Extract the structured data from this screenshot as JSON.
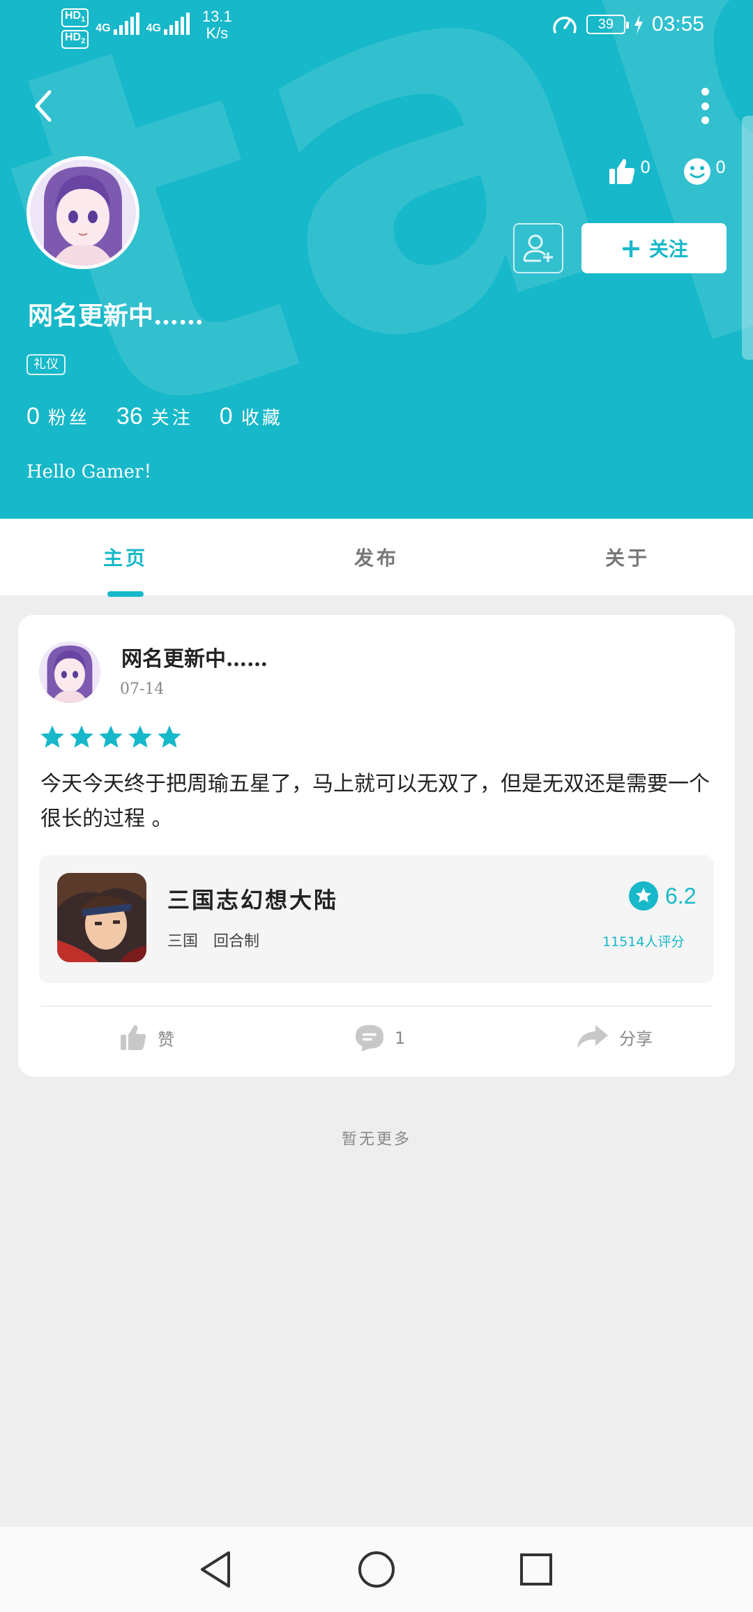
{
  "status_bar": {
    "hd1": "HD",
    "hd1_sub": "1",
    "hd2": "HD",
    "hd2_sub": "2",
    "net1": "4G",
    "net2": "4G",
    "speed_value": "13.1",
    "speed_unit": "K/s",
    "battery": "39",
    "time": "03:55"
  },
  "header": {
    "watermark": "tapTap",
    "like_count": "0",
    "face_count": "0",
    "follow_label": "关注",
    "user_name": "网名更新中……",
    "tag": "礼仪",
    "stats": [
      {
        "num": "0",
        "label": "粉丝"
      },
      {
        "num": "36",
        "label": "关注"
      },
      {
        "num": "0",
        "label": "收藏"
      }
    ],
    "bio": "Hello Gamer！"
  },
  "tabs": [
    {
      "label": "主页",
      "active": true
    },
    {
      "label": "发布",
      "active": false
    },
    {
      "label": "关于",
      "active": false
    }
  ],
  "post": {
    "user_name": "网名更新中……",
    "date": "07-14",
    "stars": 5,
    "content": "今天今天终于把周瑜五星了，马上就可以无双了，但是无双还是需要一个很长的过程 。",
    "game": {
      "title": "三国志幻想大陆",
      "tags": [
        "三国",
        "回合制"
      ],
      "rating": "6.2",
      "rating_count": "11514人评分"
    },
    "actions": {
      "like_label": "赞",
      "comment_count": "1",
      "share_label": "分享"
    }
  },
  "footer_note": "暂无更多",
  "colors": {
    "accent": "#16b8c9",
    "background": "#eeeeee",
    "card": "#ffffff"
  }
}
